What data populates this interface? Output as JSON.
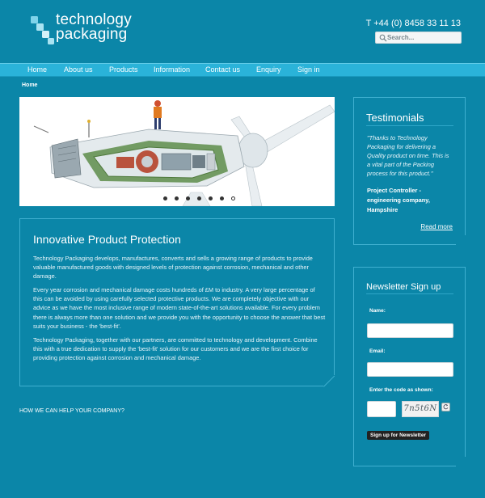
{
  "header": {
    "logo_line1": "technology",
    "logo_line2": "packaging",
    "phone": "T +44 (0) 8458 33 11 13",
    "search_placeholder": "Search..."
  },
  "nav": {
    "items": [
      "Home",
      "About us",
      "Products",
      "Information",
      "Contact us",
      "Enquiry",
      "Sign in"
    ]
  },
  "breadcrumb": "Home",
  "hero": {
    "slide_count": 7,
    "active_slide": 7
  },
  "content": {
    "title": "Innovative Product Protection",
    "paragraphs": [
      "Technology Packaging develops, manufactures, converts and sells a growing range of products to provide valuable manufactured goods with designed levels of protection against corrosion, mechanical and other damage.",
      "Every year corrosion and mechanical damage costs hundreds of £M to industry. A very large percentage of this can be avoided by using carefully selected protective products. We are completely objective with our advice as we have the most inclusive range of modern state-of-the-art solutions available. For every problem there is always more than one solution and we provide you with the opportunity to choose the answer that best suits your business - the 'best-fit'.",
      "Technology Packaging, together with our partners, are committed to technology and development. Combine this with a true dedication to supply the 'best-fit' solution for our customers and we are the first choice for providing protection against corrosion and mechanical damage."
    ],
    "help_link": "HOW WE CAN HELP YOUR COMPANY?"
  },
  "testimonials": {
    "title": "Testimonials",
    "quote": "\"Thanks to Technology Packaging for delivering a Quality product on time. This is a vital part of the Packing process for this product.\"",
    "author": "Project Controller - engineering company, Hampshire",
    "read_more": "Read more"
  },
  "newsletter": {
    "title": "Newsletter Sign up",
    "name_label": "Name:",
    "email_label": "Email:",
    "code_label": "Enter the code as shown:",
    "captcha_text": "7n5t6N",
    "button_label": "Sign up for Newsletter"
  },
  "colors": {
    "background": "#0b86a8",
    "nav": "#2ab3d9",
    "border": "#3fb0d0"
  }
}
